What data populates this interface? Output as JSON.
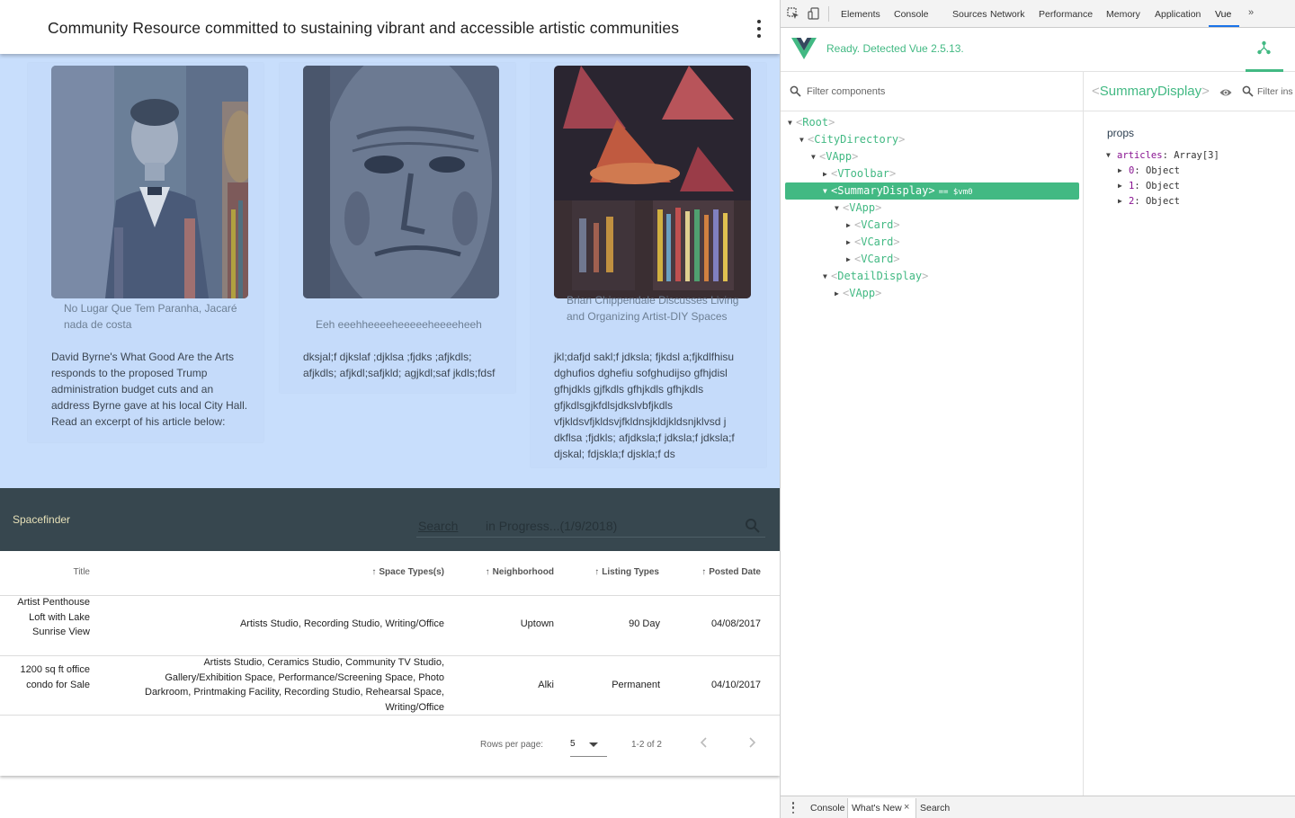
{
  "page": {
    "toolbar_title": "Community Resource committed to sustaining vibrant and accessible artistic communities",
    "cards": [
      {
        "caption": "No Lugar Que Tem Paranha, Jacaré nada de costa",
        "text": "David Byrne's What Good Are the Arts responds to the proposed Trump administration budget cuts and an address Byrne gave at his local City Hall. Read an excerpt of his article below:"
      },
      {
        "caption": "Eeh eeehheeeeheeeeeheeeeheeh",
        "text": "dksjal;f djkslaf ;djklsa ;fjdks ;afjkdls; afjkdls; afjkdl;safjkld; agjkdl;saf jkdls;fdsf"
      },
      {
        "caption": "Brian Chippendale Discusses Living and Organizing Artist-DIY Spaces",
        "text": "jkl;dafjd sakl;f jdksla; fjkdsl a;fjkdlfhisu dghufios dghefiu sofghudijso gfhjdisl gfhjdkls gjfkdls gfhjkdls gfhjkdls gfjkdlsgjkfdlsjdkslvbfjkdls vfjkldsvfjkldsvjfkldnsjkldjkldsnjklvsd j dkflsa ;fjdkls; afjdksla;f jdksla;f jdksla;f djskal; fdjskla;f djskla;f ds"
      }
    ],
    "spacefinder": {
      "title": "Spacefinder",
      "search_label": "Search",
      "search_hint": "in Progress...(1/9/2018)"
    },
    "table": {
      "headers": [
        "Title",
        "Space Types(s)",
        "Neighborhood",
        "Listing Types",
        "Posted Date"
      ],
      "rows": [
        {
          "title": "Artist Penthouse Loft with Lake Sunrise View",
          "space_types": "Artists Studio, Recording Studio, Writing/Office",
          "neighborhood": "Uptown",
          "listing_type": "90 Day",
          "posted": "04/08/2017"
        },
        {
          "title": "1200 sq ft office condo for Sale",
          "space_types": "Artists Studio, Ceramics Studio, Community TV Studio, Gallery/Exhibition Space, Performance/Screening Space, Photo Darkroom, Printmaking Facility, Recording Studio, Rehearsal Space, Writing/Office",
          "neighborhood": "Alki",
          "listing_type": "Permanent",
          "posted": "04/10/2017"
        }
      ],
      "rows_per_page_label": "Rows per page:",
      "rows_per_page_value": "5",
      "range_text": "1-2 of 2"
    }
  },
  "devtools": {
    "tabs": [
      "Elements",
      "Console",
      "Sources",
      "Network",
      "Performance",
      "Memory",
      "Application",
      "Vue"
    ],
    "more_tabs": "»",
    "active_tab": "Vue",
    "vue_status": "Ready. Detected Vue 2.5.13.",
    "filter_placeholder": "Filter components",
    "tree": [
      {
        "name": "Root",
        "depth": 0,
        "arrow": "open"
      },
      {
        "name": "CityDirectory",
        "depth": 1,
        "arrow": "open"
      },
      {
        "name": "VApp",
        "depth": 2,
        "arrow": "open"
      },
      {
        "name": "VToolbar",
        "depth": 3,
        "arrow": "closed"
      },
      {
        "name": "SummaryDisplay",
        "depth": 3,
        "arrow": "open",
        "selected": true,
        "suffix": "== $vm0"
      },
      {
        "name": "VApp",
        "depth": 4,
        "arrow": "open"
      },
      {
        "name": "VCard",
        "depth": 5,
        "arrow": "closed"
      },
      {
        "name": "VCard",
        "depth": 5,
        "arrow": "closed"
      },
      {
        "name": "VCard",
        "depth": 5,
        "arrow": "closed"
      },
      {
        "name": "DetailDisplay",
        "depth": 3,
        "arrow": "open"
      },
      {
        "name": "VApp",
        "depth": 4,
        "arrow": "closed"
      }
    ],
    "inspector": {
      "component_name": "SummaryDisplay",
      "filter_placeholder": "Filter ins",
      "section": "props",
      "prop_key": "articles",
      "prop_type": "Array[3]",
      "items": [
        {
          "key": "0",
          "value": "Object"
        },
        {
          "key": "1",
          "value": "Object"
        },
        {
          "key": "2",
          "value": "Object"
        }
      ]
    },
    "drawer_tabs": [
      "Console",
      "What's New",
      "Search"
    ],
    "colors": {
      "vue_green": "#42b983",
      "vue_dark": "#35495e",
      "tab_accent": "#1a73e8"
    }
  }
}
